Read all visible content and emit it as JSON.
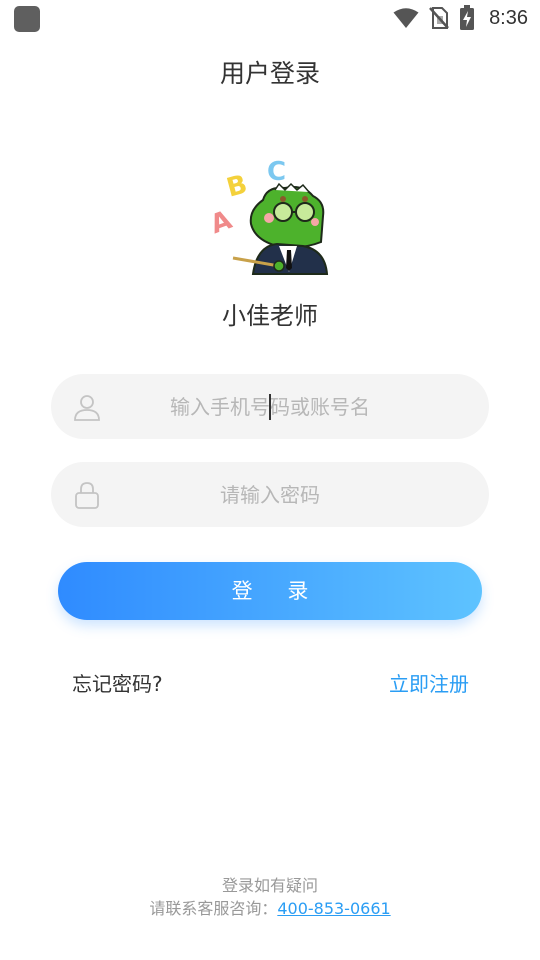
{
  "status_bar": {
    "time": "8:36",
    "icons": [
      "app-icon",
      "wifi-icon",
      "no-sim-icon",
      "battery-charging-icon"
    ]
  },
  "header": {
    "title": "用户登录"
  },
  "brand": {
    "logo": "crocodile-teacher-logo",
    "logo_letters": [
      "A",
      "B",
      "C"
    ],
    "name": "小佳老师"
  },
  "form": {
    "account": {
      "placeholder": "输入手机号码或账号名",
      "value": "",
      "icon": "user-icon"
    },
    "password": {
      "placeholder": "请输入密码",
      "value": "",
      "icon": "lock-icon"
    },
    "login_label": "登 录"
  },
  "links": {
    "forgot": "忘记密码?",
    "register": "立即注册"
  },
  "footer": {
    "line1": "登录如有疑问",
    "line2_prefix": "请联系客服咨询：",
    "phone": "400-853-0661"
  },
  "colors": {
    "accent": "#2a9df4",
    "button_start": "#2f8bff",
    "button_end": "#5ec3ff",
    "field_bg": "#f4f4f4"
  }
}
